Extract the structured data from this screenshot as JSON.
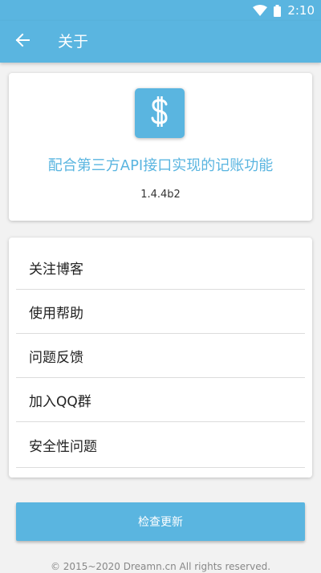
{
  "status_bar": {
    "time": "2:10",
    "icons": [
      "wifi-icon",
      "battery-icon"
    ],
    "color": "#5ab5e0"
  },
  "app_bar": {
    "title": "关于",
    "back_icon": "arrow-back-icon"
  },
  "about": {
    "logo_icon": "dollar-icon",
    "tagline": "配合第三方API接口实现的记账功能",
    "version": "1.4.4b2"
  },
  "menu": {
    "items": [
      {
        "label": "关注博客"
      },
      {
        "label": "使用帮助"
      },
      {
        "label": "问题反馈"
      },
      {
        "label": "加入QQ群"
      },
      {
        "label": "安全性问题"
      }
    ]
  },
  "update_button": {
    "label": "检查更新"
  },
  "footer": {
    "copyright": "© 2015~2020 Dreamn.cn All rights reserved."
  },
  "colors": {
    "accent": "#5ab5e0",
    "background": "#f2f2f2"
  }
}
